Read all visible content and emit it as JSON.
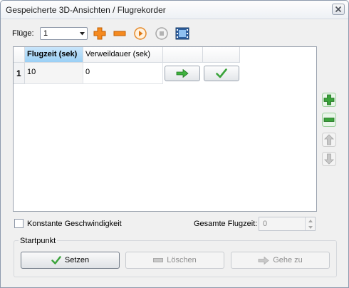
{
  "window": {
    "title": "Gespeicherte 3D-Ansichten / Flugrekorder"
  },
  "toolbar": {
    "flights_label": "Flüge:",
    "flight_select_value": "1"
  },
  "grid": {
    "columns": [
      "Flugzeit (sek)",
      "Verweildauer (sek)"
    ],
    "rows": [
      {
        "index": "1",
        "flight_time": "10",
        "dwell_time": "0"
      }
    ]
  },
  "options": {
    "constant_speed_label": "Konstante Geschwindigkeit",
    "constant_speed_checked": false,
    "total_time_label": "Gesamte Flugzeit:",
    "total_time_value": "0"
  },
  "startpoint": {
    "group_label": "Startpunkt",
    "set_label": "Setzen",
    "delete_label": "Löschen",
    "goto_label": "Gehe zu"
  },
  "colors": {
    "accent_orange": "#f07d17",
    "accent_green": "#3aa33a",
    "header_selected": "#9bd0f5"
  }
}
